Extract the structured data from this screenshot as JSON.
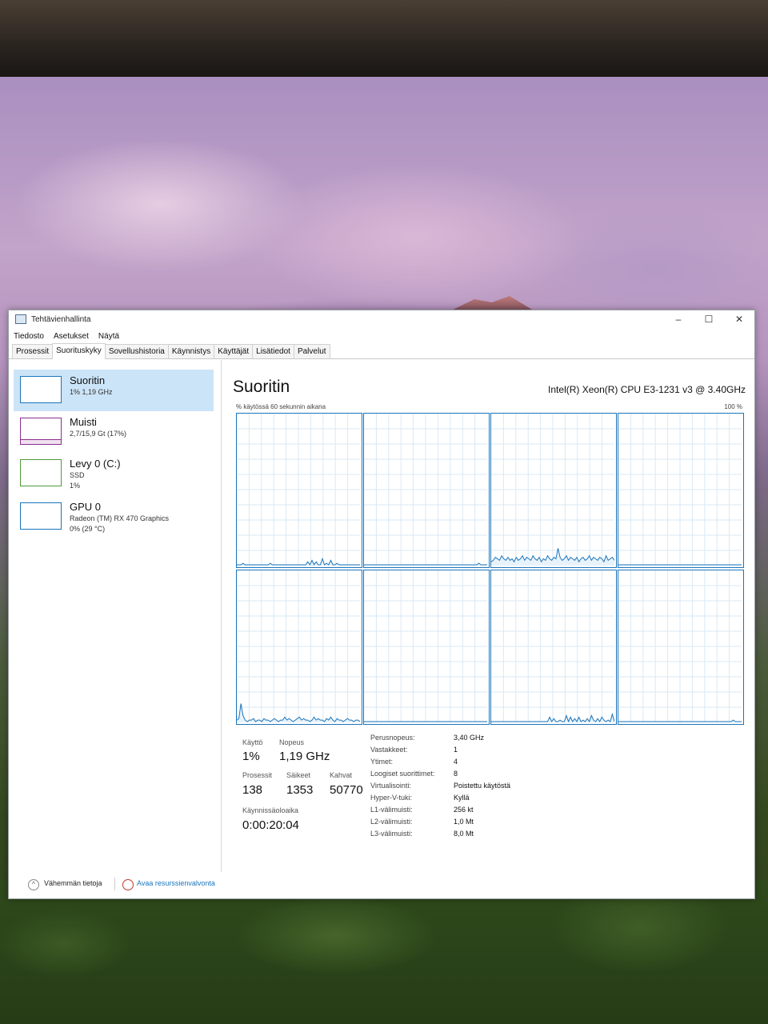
{
  "window": {
    "title": "Tehtävienhallinta",
    "controls": [
      "–",
      "☐",
      "✕"
    ]
  },
  "menu": [
    "Tiedosto",
    "Asetukset",
    "Näytä"
  ],
  "tabs": [
    "Prosessit",
    "Suorituskyky",
    "Sovellushistoria",
    "Käynnistys",
    "Käyttäjät",
    "Lisätiedot",
    "Palvelut"
  ],
  "active_tab": "Suorituskyky",
  "sidebar": {
    "items": [
      {
        "name": "Suoritin",
        "line1": "1% 1,19 GHz",
        "line2": "",
        "line3": "",
        "color": "#1b75bb"
      },
      {
        "name": "Muisti",
        "line1": "2,7/15,9 Gt (17%)",
        "line2": "",
        "line3": "",
        "color": "#8b2f8f"
      },
      {
        "name": "Levy 0 (C:)",
        "line1": "SSD",
        "line2": "1%",
        "line3": "",
        "color": "#4f9a3a"
      },
      {
        "name": "GPU 0",
        "line1": "Radeon (TM) RX 470 Graphics",
        "line2": "0% (29 °C)",
        "line3": "",
        "color": "#1b75bb"
      }
    ]
  },
  "main": {
    "title": "Suoritin",
    "cpu_name": "Intel(R) Xeon(R) CPU E3-1231 v3 @ 3.40GHz",
    "graph_label": "% käytössä 60 sekunnin aikana",
    "graph_max": "100 %",
    "accent": "#1b75bb"
  },
  "core_usage": [
    [
      0,
      0,
      0,
      1,
      0,
      0,
      0,
      0,
      0,
      0,
      0,
      0,
      0,
      0,
      0,
      0,
      1,
      0,
      0,
      0,
      0,
      0,
      0,
      0,
      0,
      0,
      0,
      0,
      0,
      0,
      0,
      0,
      0,
      0,
      2,
      0,
      3,
      0,
      2,
      0,
      0,
      4,
      0,
      1,
      0,
      3,
      0,
      0,
      1,
      0,
      0,
      0,
      0,
      0,
      0,
      0,
      0,
      0,
      0,
      0
    ],
    [
      0,
      0,
      0,
      0,
      0,
      0,
      0,
      0,
      0,
      0,
      0,
      0,
      0,
      0,
      0,
      0,
      0,
      0,
      0,
      0,
      0,
      0,
      0,
      0,
      0,
      0,
      0,
      0,
      0,
      0,
      0,
      0,
      0,
      0,
      0,
      0,
      0,
      0,
      0,
      0,
      0,
      0,
      0,
      0,
      0,
      0,
      0,
      0,
      0,
      0,
      0,
      0,
      0,
      0,
      0,
      1,
      0,
      0,
      0,
      0
    ],
    [
      2,
      3,
      5,
      4,
      3,
      6,
      4,
      3,
      5,
      3,
      4,
      2,
      5,
      3,
      4,
      6,
      3,
      5,
      4,
      3,
      6,
      4,
      3,
      5,
      2,
      4,
      3,
      6,
      4,
      3,
      5,
      4,
      11,
      5,
      3,
      4,
      6,
      3,
      5,
      4,
      3,
      5,
      2,
      4,
      5,
      3,
      4,
      6,
      3,
      5,
      4,
      3,
      5,
      4,
      2,
      6,
      3,
      4,
      5,
      3
    ],
    [
      0,
      0,
      0,
      0,
      0,
      0,
      0,
      0,
      0,
      0,
      0,
      0,
      0,
      0,
      0,
      0,
      0,
      0,
      0,
      0,
      0,
      0,
      0,
      0,
      0,
      0,
      0,
      0,
      0,
      0,
      0,
      0,
      0,
      0,
      0,
      0,
      0,
      0,
      0,
      0,
      0,
      0,
      0,
      0,
      0,
      0,
      0,
      0,
      0,
      0,
      0,
      0,
      0,
      0,
      0,
      0,
      0,
      0,
      0,
      0
    ],
    [
      1,
      2,
      12,
      4,
      1,
      0,
      1,
      1,
      2,
      0,
      1,
      1,
      0,
      2,
      1,
      1,
      0,
      1,
      2,
      1,
      0,
      1,
      1,
      3,
      1,
      2,
      1,
      0,
      1,
      2,
      3,
      1,
      2,
      1,
      1,
      0,
      1,
      3,
      1,
      2,
      1,
      1,
      0,
      2,
      1,
      3,
      1,
      0,
      2,
      1,
      1,
      0,
      1,
      2,
      1,
      1,
      0,
      1,
      1,
      0
    ],
    [
      0,
      0,
      0,
      0,
      0,
      0,
      0,
      0,
      0,
      0,
      0,
      0,
      0,
      0,
      0,
      0,
      0,
      0,
      0,
      0,
      0,
      0,
      0,
      0,
      0,
      0,
      0,
      0,
      0,
      0,
      0,
      0,
      0,
      0,
      0,
      0,
      0,
      0,
      0,
      0,
      0,
      0,
      0,
      0,
      0,
      0,
      0,
      0,
      0,
      0,
      0,
      0,
      0,
      0,
      0,
      0,
      0,
      0,
      0,
      0
    ],
    [
      0,
      0,
      0,
      0,
      0,
      0,
      0,
      0,
      0,
      0,
      0,
      0,
      0,
      0,
      0,
      0,
      0,
      0,
      0,
      0,
      0,
      0,
      0,
      0,
      0,
      0,
      0,
      0,
      3,
      0,
      2,
      0,
      0,
      1,
      0,
      0,
      4,
      0,
      3,
      0,
      2,
      0,
      3,
      0,
      1,
      0,
      2,
      0,
      4,
      1,
      0,
      2,
      0,
      3,
      1,
      0,
      1,
      0,
      5,
      0
    ],
    [
      0,
      0,
      0,
      0,
      0,
      0,
      0,
      0,
      0,
      0,
      0,
      0,
      0,
      0,
      0,
      0,
      0,
      0,
      0,
      0,
      0,
      0,
      0,
      0,
      0,
      0,
      0,
      0,
      0,
      0,
      0,
      0,
      0,
      0,
      0,
      0,
      0,
      0,
      0,
      0,
      0,
      0,
      0,
      0,
      0,
      0,
      0,
      0,
      0,
      0,
      0,
      0,
      0,
      0,
      0,
      1,
      0,
      0,
      0,
      0
    ]
  ],
  "stats": {
    "usage_label": "Käyttö",
    "usage": "1%",
    "speed_label": "Nopeus",
    "speed": "1,19 GHz",
    "proc_label": "Prosessit",
    "proc": "138",
    "threads_label": "Säikeet",
    "threads": "1353",
    "handles_label": "Kahvat",
    "handles": "50770",
    "uptime_label": "Käynnissäoloaika",
    "uptime": "0:00:20:04"
  },
  "details": [
    {
      "key": "Perusnopeus:",
      "value": "3,40 GHz"
    },
    {
      "key": "Vastakkeet:",
      "value": "1"
    },
    {
      "key": "Ytimet:",
      "value": "4"
    },
    {
      "key": "Loogiset suorittimet:",
      "value": "8"
    },
    {
      "key": "Virtualisointi:",
      "value": "Poistettu käytöstä"
    },
    {
      "key": "Hyper-V-tuki:",
      "value": "Kyllä"
    },
    {
      "key": "L1-välimuisti:",
      "value": "256 kt"
    },
    {
      "key": "L2-välimuisti:",
      "value": "1,0 Mt"
    },
    {
      "key": "L3-välimuisti:",
      "value": "8,0 Mt"
    }
  ],
  "footer": {
    "less": "Vähemmän tietoja",
    "resmon": "Avaa resurssienvalvonta"
  }
}
